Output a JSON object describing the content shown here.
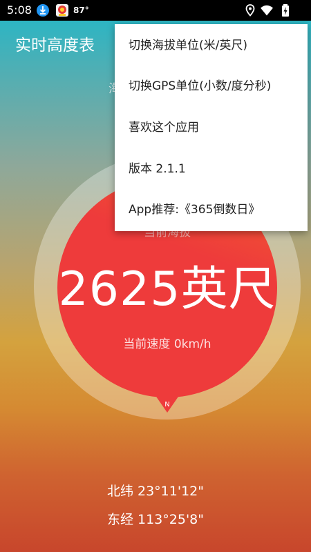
{
  "status_bar": {
    "time": "5:08",
    "temperature": "87°",
    "icons": [
      "download-icon",
      "app-notification-icon",
      "location-icon",
      "wifi-icon",
      "battery-icon"
    ]
  },
  "app": {
    "title": "实时高度表"
  },
  "behind_menu_text": "海",
  "gauge": {
    "label": "当前海拔",
    "altitude": "2625英尺",
    "speed": "当前速度 0km/h",
    "north": "N"
  },
  "coordinates": {
    "latitude": "北纬 23°11'12\"",
    "longitude": "东经 113°25'8\""
  },
  "menu": {
    "items": [
      {
        "label": "切换海拔单位(米/英尺)"
      },
      {
        "label": "切换GPS单位(小数/度分秒)"
      },
      {
        "label": "喜欢这个应用"
      },
      {
        "label": "版本 2.1.1"
      },
      {
        "label": "App推荐:《365倒数日》"
      }
    ]
  },
  "colors": {
    "gauge_red": "#ee3b3b",
    "gradient_top": "#1fb7c9",
    "gradient_bottom": "#c8462c"
  }
}
